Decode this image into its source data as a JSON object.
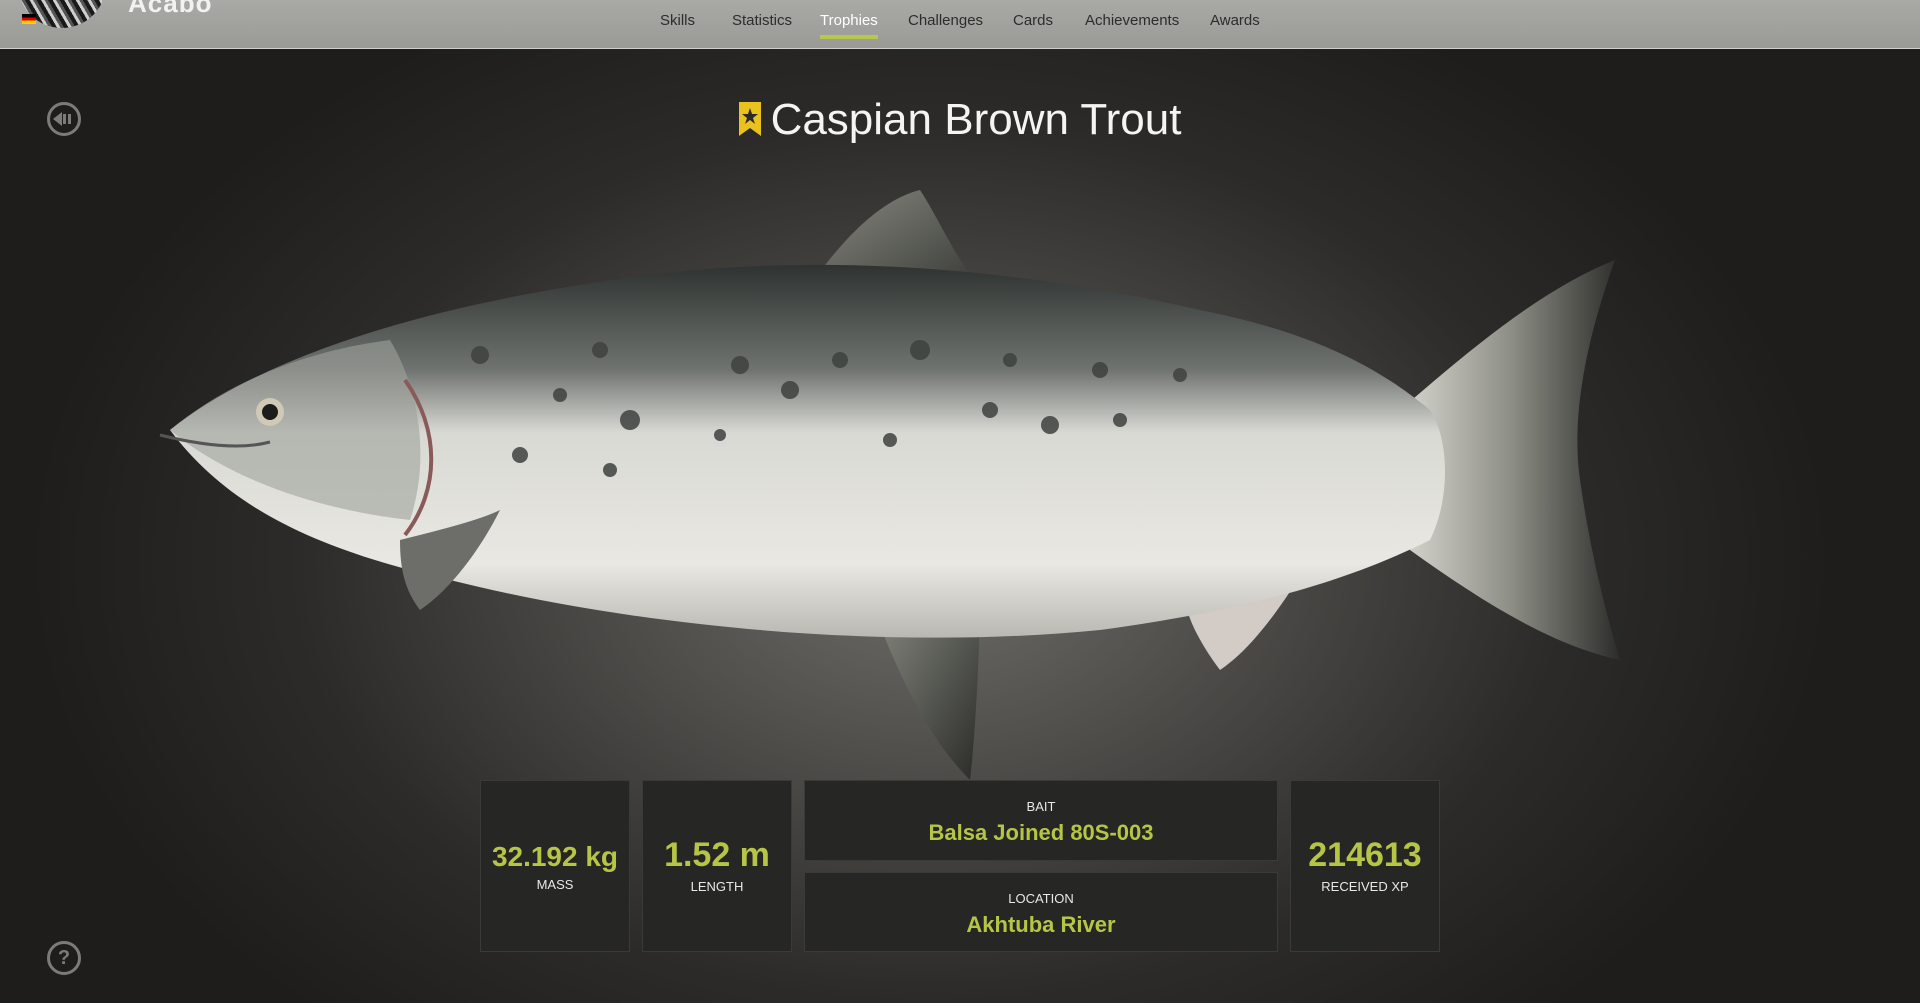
{
  "player": {
    "name": "Acabo"
  },
  "nav": {
    "tabs": [
      {
        "label": "Skills"
      },
      {
        "label": "Statistics"
      },
      {
        "label": "Trophies"
      },
      {
        "label": "Challenges"
      },
      {
        "label": "Cards"
      },
      {
        "label": "Achievements"
      },
      {
        "label": "Awards"
      }
    ],
    "active": "Trophies"
  },
  "trophy": {
    "title": "Caspian Brown Trout",
    "mass": {
      "value": "32.192 kg",
      "label": "MASS"
    },
    "length": {
      "value": "1.52 m",
      "label": "LENGTH"
    },
    "bait": {
      "label": "BAIT",
      "value": "Balsa Joined 80S-003"
    },
    "location": {
      "label": "LOCATION",
      "value": "Akhtuba River"
    },
    "xp": {
      "value": "214613",
      "label": "RECEIVED XP"
    }
  },
  "icons": {
    "back": "back-arrow-icon",
    "help": "help-icon",
    "bookmark": "bookmark-star-icon"
  },
  "colors": {
    "accent": "#b7c546",
    "bookmark": "#e9c21d"
  }
}
